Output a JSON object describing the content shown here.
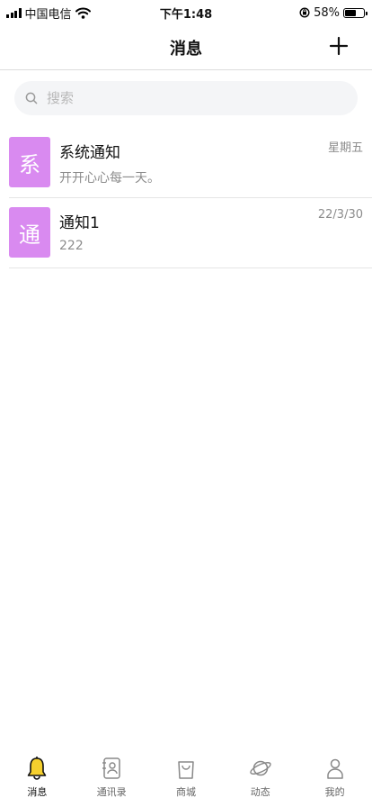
{
  "status_bar": {
    "carrier": "中国电信",
    "time": "下午1:48",
    "battery": "58%",
    "battery_level": 0.58
  },
  "nav": {
    "title": "消息",
    "add_icon": "plus-icon"
  },
  "search": {
    "placeholder": "搜索",
    "value": "",
    "icon": "search-icon"
  },
  "messages": [
    {
      "avatar": "系",
      "title": "系统通知",
      "preview": "开开心心每一天。",
      "time": "星期五",
      "color": "#d98af0"
    },
    {
      "avatar": "通",
      "title": "通知1",
      "preview": "222",
      "time": "22/3/30",
      "color": "#d98af0"
    }
  ],
  "tabs": [
    {
      "label": "消息",
      "icon": "bell-icon",
      "active": true
    },
    {
      "label": "通讯录",
      "icon": "contacts-book-icon",
      "active": false
    },
    {
      "label": "商城",
      "icon": "shopping-bag-icon",
      "active": false
    },
    {
      "label": "动态",
      "icon": "planet-icon",
      "active": false
    },
    {
      "label": "我的",
      "icon": "person-icon",
      "active": false
    }
  ],
  "colors": {
    "accent_yellow": "#f5d02e",
    "avatar_purple": "#d98af0"
  }
}
